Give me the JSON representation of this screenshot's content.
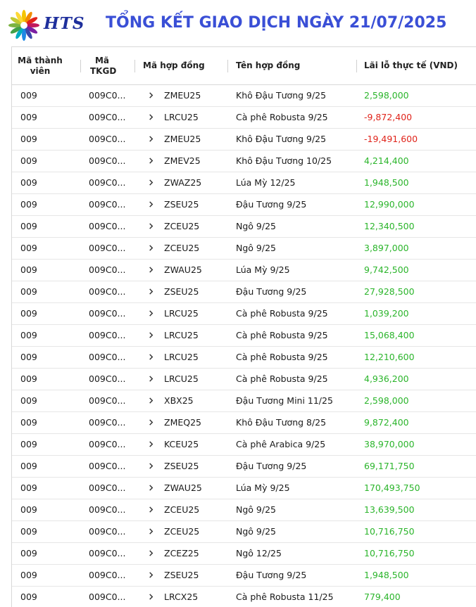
{
  "brand": {
    "logo_text": "HTS"
  },
  "page": {
    "title": "TỔNG KẾT GIAO DỊCH NGÀY 21/07/2025"
  },
  "columns": [
    {
      "label": "Mã thành viên"
    },
    {
      "label": "Mã TKGD"
    },
    {
      "label": "Mã hợp đồng"
    },
    {
      "label": "Tên hợp đồng"
    },
    {
      "label": "Lãi lỗ thực tế (VND)"
    }
  ],
  "rows": [
    {
      "member": "009",
      "account": "009C0...",
      "code": "ZMEU25",
      "name": "Khô Đậu Tương 9/25",
      "pnl": "2,598,000",
      "sign": "pos"
    },
    {
      "member": "009",
      "account": "009C0...",
      "code": "LRCU25",
      "name": "Cà phê Robusta 9/25",
      "pnl": "-9,872,400",
      "sign": "neg"
    },
    {
      "member": "009",
      "account": "009C0...",
      "code": "ZMEU25",
      "name": "Khô Đậu Tương 9/25",
      "pnl": "-19,491,600",
      "sign": "neg"
    },
    {
      "member": "009",
      "account": "009C0...",
      "code": "ZMEV25",
      "name": "Khô Đậu Tương 10/25",
      "pnl": "4,214,400",
      "sign": "pos"
    },
    {
      "member": "009",
      "account": "009C0...",
      "code": "ZWAZ25",
      "name": "Lúa Mỳ 12/25",
      "pnl": "1,948,500",
      "sign": "pos"
    },
    {
      "member": "009",
      "account": "009C0...",
      "code": "ZSEU25",
      "name": "Đậu Tương 9/25",
      "pnl": "12,990,000",
      "sign": "pos"
    },
    {
      "member": "009",
      "account": "009C0...",
      "code": "ZCEU25",
      "name": "Ngô 9/25",
      "pnl": "12,340,500",
      "sign": "pos"
    },
    {
      "member": "009",
      "account": "009C0...",
      "code": "ZCEU25",
      "name": "Ngô 9/25",
      "pnl": "3,897,000",
      "sign": "pos"
    },
    {
      "member": "009",
      "account": "009C0...",
      "code": "ZWAU25",
      "name": "Lúa Mỳ 9/25",
      "pnl": "9,742,500",
      "sign": "pos"
    },
    {
      "member": "009",
      "account": "009C0...",
      "code": "ZSEU25",
      "name": "Đậu Tương 9/25",
      "pnl": "27,928,500",
      "sign": "pos"
    },
    {
      "member": "009",
      "account": "009C0...",
      "code": "LRCU25",
      "name": "Cà phê Robusta 9/25",
      "pnl": "1,039,200",
      "sign": "pos"
    },
    {
      "member": "009",
      "account": "009C0...",
      "code": "LRCU25",
      "name": "Cà phê Robusta 9/25",
      "pnl": "15,068,400",
      "sign": "pos"
    },
    {
      "member": "009",
      "account": "009C0...",
      "code": "LRCU25",
      "name": "Cà phê Robusta 9/25",
      "pnl": "12,210,600",
      "sign": "pos"
    },
    {
      "member": "009",
      "account": "009C0...",
      "code": "LRCU25",
      "name": "Cà phê Robusta 9/25",
      "pnl": "4,936,200",
      "sign": "pos"
    },
    {
      "member": "009",
      "account": "009C0...",
      "code": "XBX25",
      "name": "Đậu Tương Mini 11/25",
      "pnl": "2,598,000",
      "sign": "pos"
    },
    {
      "member": "009",
      "account": "009C0...",
      "code": "ZMEQ25",
      "name": "Khô Đậu Tương 8/25",
      "pnl": "9,872,400",
      "sign": "pos"
    },
    {
      "member": "009",
      "account": "009C0...",
      "code": "KCEU25",
      "name": "Cà phê Arabica 9/25",
      "pnl": "38,970,000",
      "sign": "pos"
    },
    {
      "member": "009",
      "account": "009C0...",
      "code": "ZSEU25",
      "name": "Đậu Tương 9/25",
      "pnl": "69,171,750",
      "sign": "pos"
    },
    {
      "member": "009",
      "account": "009C0...",
      "code": "ZWAU25",
      "name": "Lúa Mỳ 9/25",
      "pnl": "170,493,750",
      "sign": "pos"
    },
    {
      "member": "009",
      "account": "009C0...",
      "code": "ZCEU25",
      "name": "Ngô 9/25",
      "pnl": "13,639,500",
      "sign": "pos"
    },
    {
      "member": "009",
      "account": "009C0...",
      "code": "ZCEU25",
      "name": "Ngô 9/25",
      "pnl": "10,716,750",
      "sign": "pos"
    },
    {
      "member": "009",
      "account": "009C0...",
      "code": "ZCEZ25",
      "name": "Ngô 12/25",
      "pnl": "10,716,750",
      "sign": "pos"
    },
    {
      "member": "009",
      "account": "009C0...",
      "code": "ZSEU25",
      "name": "Đậu Tương 9/25",
      "pnl": "1,948,500",
      "sign": "pos"
    },
    {
      "member": "009",
      "account": "009C0...",
      "code": "LRCX25",
      "name": "Cà phê Robusta 11/25",
      "pnl": "779,400",
      "sign": "pos"
    }
  ],
  "colors": {
    "positive": "#2bb52b",
    "negative": "#e0241b",
    "title": "#3a4fd6",
    "brand": "#1e2f9c"
  },
  "icons": {
    "row_expand": "chevron-right-icon"
  }
}
